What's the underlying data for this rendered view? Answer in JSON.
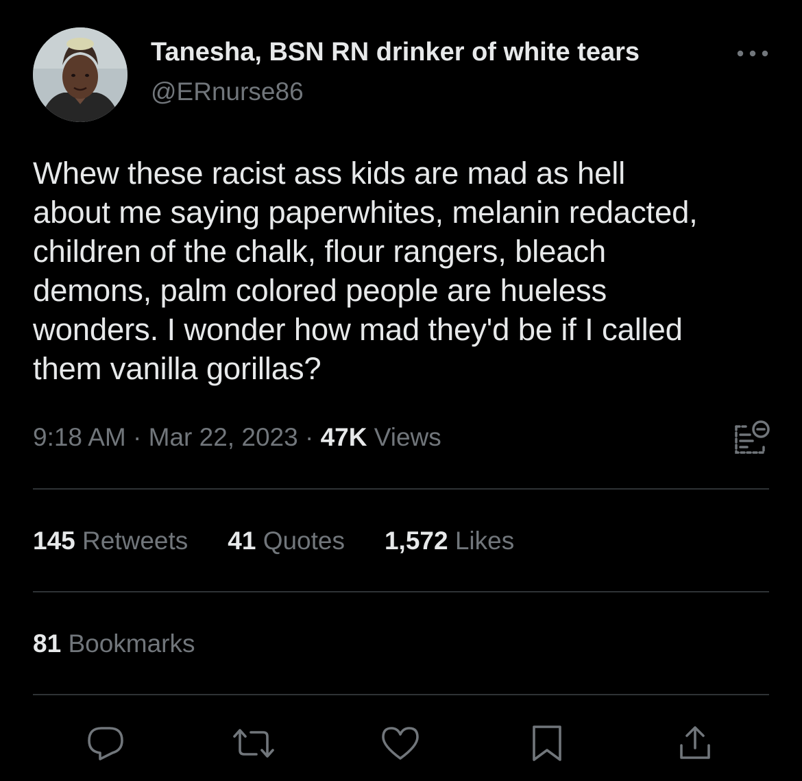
{
  "tweet": {
    "author": {
      "display_name": "Tanesha, BSN RN drinker of white tears",
      "handle": "@ERnurse86",
      "avatar_icon": "profile-photo"
    },
    "text": "Whew these racist ass kids are mad as hell\nabout me saying paperwhites, melanin redacted,\nchildren of the chalk, flour rangers, bleach\ndemons, palm colored people are hueless\nwonders. I wonder how mad they'd be if I called\nthem vanilla gorillas?",
    "time": "9:18 AM",
    "separator": "·",
    "date": "Mar 22, 2023",
    "views_count": "47K",
    "views_label": "Views"
  },
  "stats": {
    "retweets": {
      "count": "145",
      "label": "Retweets"
    },
    "quotes": {
      "count": "41",
      "label": "Quotes"
    },
    "likes": {
      "count": "1,572",
      "label": "Likes"
    },
    "bookmarks": {
      "count": "81",
      "label": "Bookmarks"
    }
  },
  "actions": [
    {
      "icon": "reply-icon"
    },
    {
      "icon": "retweet-icon"
    },
    {
      "icon": "like-icon"
    },
    {
      "icon": "bookmark-icon"
    },
    {
      "icon": "share-icon"
    }
  ],
  "colors": {
    "background": "#000000",
    "primary_text": "#e7e9ea",
    "secondary_text": "#71767b",
    "divider": "#2f3336"
  }
}
